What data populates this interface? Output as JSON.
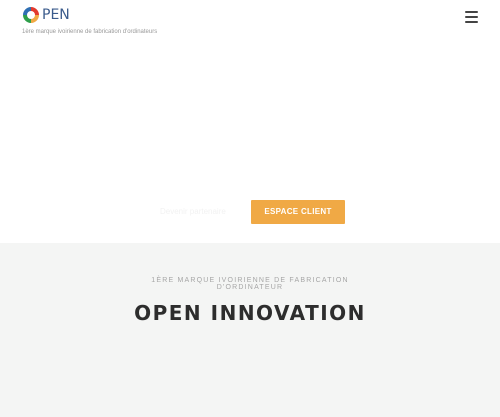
{
  "header": {
    "logo_text": "PEN",
    "tagline": "1ère marque ivoirienne de fabrication d'ordinateurs",
    "menu_icon": "hamburger-menu-icon"
  },
  "hero": {
    "faint_link": "Devenir partenaire",
    "espace_client_label": "ESPACE CLIENT"
  },
  "section": {
    "kicker": "1ère marque ivoirienne de fabrication d'ordinateur",
    "title": "OPEN INNOVATION"
  },
  "colors": {
    "accent": "#f0a945",
    "logo_blue": "#3b5b8c",
    "section_bg": "#f4f5f4",
    "title_color": "#2d2d2d"
  }
}
